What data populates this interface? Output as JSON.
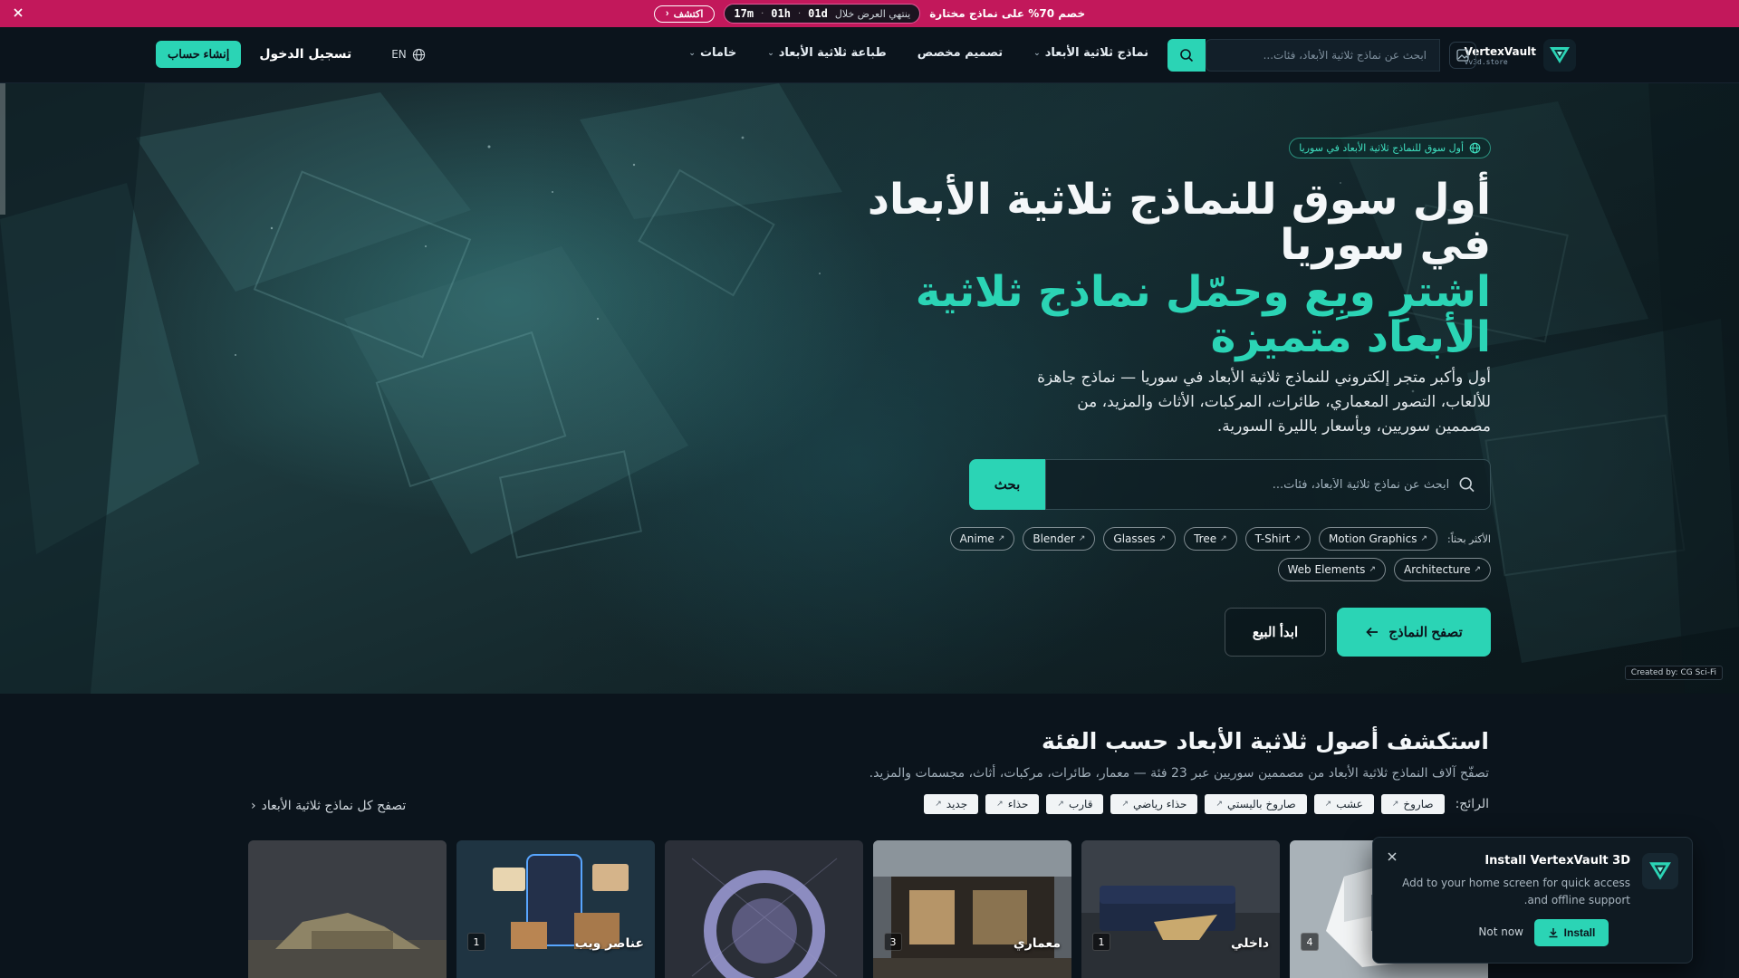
{
  "promo": {
    "text": "خصم 70% على نماذج مختارة",
    "ends_label": "ينتهي العرض خلال",
    "days": "01d",
    "hours": "01h",
    "minutes": "17m",
    "discover_label": "اكتشف"
  },
  "brand": {
    "name": "VertexVault",
    "sub": "vv3d.store"
  },
  "header": {
    "search_placeholder": "ابحث عن نماذج ثلاثية الأبعاد، فئات...",
    "nav": [
      {
        "label": "نماذج ثلاثية الأبعاد",
        "dropdown": true
      },
      {
        "label": "تصميم مخصص",
        "dropdown": false
      },
      {
        "label": "طباعة ثلاثية الأبعاد",
        "dropdown": true
      },
      {
        "label": "خامات",
        "dropdown": true
      }
    ],
    "signup_label": "إنشاء حساب",
    "login_label": "تسجيل الدخول",
    "lang_label": "EN"
  },
  "hero": {
    "badge": "أول سوق للنماذج ثلاثية الأبعاد في سوريا",
    "title_line": "أول سوق للنماذج ثلاثية الأبعاد في سوريا",
    "title_accent": "اشترِ وبِع وحمّل نماذج ثلاثية الأبعاد متميزة",
    "description": "أول وأكبر متجر إلكتروني للنماذج ثلاثية الأبعاد في سوريا — نماذج جاهزة للألعاب، التصور المعماري، طائرات، المركبات، الأثاث والمزيد، من مصممين سوريين، وبأسعار بالليرة السورية.",
    "search_placeholder": "ابحث عن نماذج ثلاثية الأبعاد، فئات...",
    "search_button": "بحث",
    "popular_label": "الأكثر بحثاً:",
    "tags": [
      "Motion Graphics",
      "T-Shirt",
      "Tree",
      "Glasses",
      "Blender",
      "Anime",
      "Architecture",
      "Web Elements"
    ],
    "browse_button": "تصفح النماذج",
    "sell_button": "ابدأ البيع",
    "credit": "Created by: CG Sci-Fi"
  },
  "categories": {
    "title": "استكشف أصول ثلاثية الأبعاد حسب الفئة",
    "subtitle": "تصفّح آلاف النماذج ثلاثية الأبعاد من مصممين سوريين عبر 23 فئة — معمار، طائرات، مركبات، أثاث، مجسمات والمزيد.",
    "trending_label": "الرائج:",
    "trending": [
      "صاروخ",
      "عشب",
      "صاروخ باليستي",
      "حذاء رياضي",
      "قارب",
      "حذاء",
      "جديد"
    ],
    "browse_all": "تصفح كل نماذج ثلاثية الأبعاد",
    "cards": [
      {
        "name": "",
        "count": "4"
      },
      {
        "name": "داخلي",
        "count": "1"
      },
      {
        "name": "معماري",
        "count": "3"
      },
      {
        "name": "",
        "count": ""
      },
      {
        "name": "عناصر ويب",
        "count": "1"
      },
      {
        "name": "",
        "count": ""
      }
    ]
  },
  "install": {
    "title": "Install VertexVault 3D",
    "description": "Add to your home screen for quick access and offline support.",
    "install_label": "Install",
    "not_now_label": "Not now"
  },
  "colors": {
    "accent": "#2bd4b5",
    "promo": "#c2185b",
    "background": "#0b141c"
  }
}
